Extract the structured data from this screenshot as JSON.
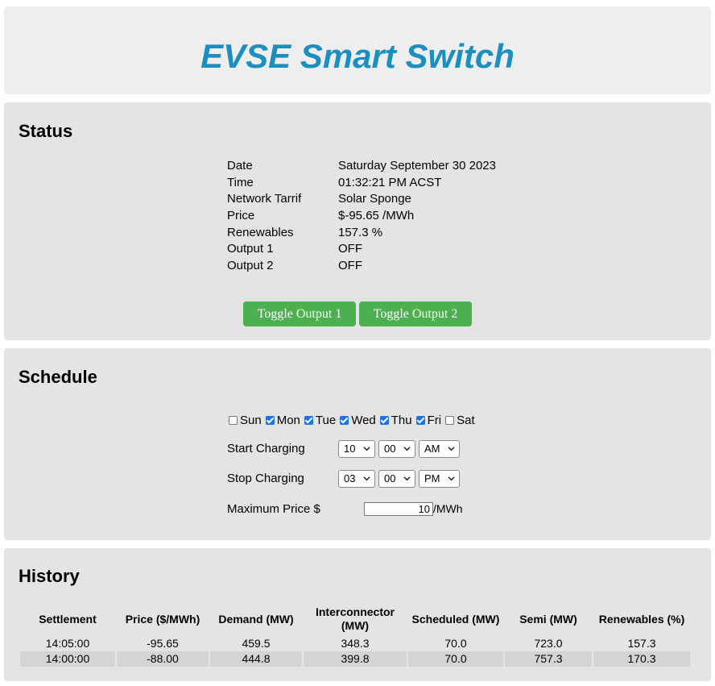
{
  "header": {
    "title": "EVSE Smart Switch"
  },
  "status": {
    "title": "Status",
    "rows": [
      {
        "label": "Date",
        "value": "Saturday September 30 2023"
      },
      {
        "label": "Time",
        "value": "01:32:21 PM ACST"
      },
      {
        "label": "Network Tarrif",
        "value": "Solar Sponge"
      },
      {
        "label": "Price",
        "value": "$-95.65 /MWh"
      },
      {
        "label": "Renewables",
        "value": "157.3 %"
      },
      {
        "label": "Output 1",
        "value": "OFF"
      },
      {
        "label": "Output 2",
        "value": "OFF"
      }
    ],
    "toggle1_label": "Toggle Output 1",
    "toggle2_label": "Toggle Output 2",
    "button_color": "#4caf50"
  },
  "schedule": {
    "title": "Schedule",
    "days": [
      {
        "label": "Sun",
        "checked": false
      },
      {
        "label": "Mon",
        "checked": true
      },
      {
        "label": "Tue",
        "checked": true
      },
      {
        "label": "Wed",
        "checked": true
      },
      {
        "label": "Thu",
        "checked": true
      },
      {
        "label": "Fri",
        "checked": true
      },
      {
        "label": "Sat",
        "checked": false
      }
    ],
    "start": {
      "label": "Start Charging",
      "hour": "10",
      "minute": "00",
      "ampm": "AM"
    },
    "stop": {
      "label": "Stop Charging",
      "hour": "03",
      "minute": "00",
      "ampm": "PM"
    },
    "max_price": {
      "label": "Maximum Price $",
      "value": "10",
      "unit": "/MWh"
    }
  },
  "history": {
    "title": "History",
    "columns": [
      "Settlement",
      "Price ($/MWh)",
      "Demand (MW)",
      "Interconnector (MW)",
      "Scheduled (MW)",
      "Semi (MW)",
      "Renewables (%)"
    ],
    "rows": [
      [
        "14:05:00",
        "-95.65",
        "459.5",
        "348.3",
        "70.0",
        "723.0",
        "157.3"
      ],
      [
        "14:00:00",
        "-88.00",
        "444.8",
        "399.8",
        "70.0",
        "757.3",
        "170.3"
      ]
    ]
  },
  "colors": {
    "title": "#1c8fc1",
    "checkbox": "#1a73e8",
    "panel": "#e4e4e4"
  }
}
